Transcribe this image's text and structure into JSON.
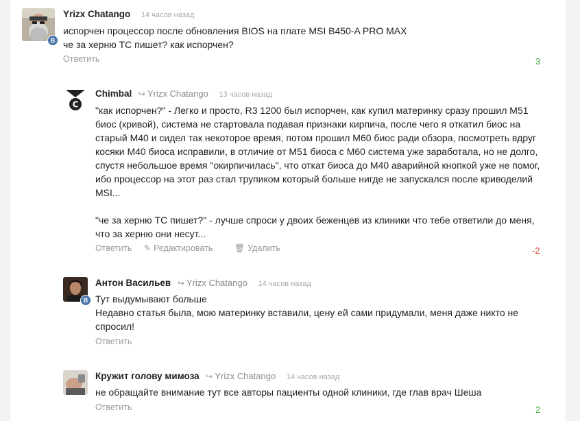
{
  "comments": [
    {
      "author": "Yrizx Chatango",
      "reply_to": "",
      "time": "14 часов назад",
      "lines": [
        "испорчен процессор после обновления BIOS на плате MSI B450-A PRO MAX",
        "че за херню ТС пишет? как испорчен?"
      ],
      "actions": [
        "Ответить"
      ],
      "score": "3",
      "score_color": "#3fa93f",
      "avatar_icon": "bearded-man-avatar",
      "badge": "B"
    },
    {
      "author": "Chimbal",
      "reply_to": "Yrizx Chatango",
      "time": "13 часов назад",
      "lines": [
        "\"как испорчен?\" - Легко и просто, R3 1200 был испорчен, как купил материнку сразу прошил M51",
        "биос (кривой), система не стартовала подавая признаки кирпича, после чего я откатил биос на",
        "старый M40 и сидел так некоторое время, потом прошил M60 биос ради обзора, посмотреть вдруг",
        "косяки M40 биоса исправили, в отличие от M51 биоса с M60 система уже заработала, но не долго,",
        "спустя небольшое время \"окирпичилась\", что откат биоса до M40 аварийной кнопкой уже не помог,",
        "ибо процессор на этот раз стал трупиком который больше нигде не запускался после криводелий",
        "MSI...",
        "",
        "\"че за херню ТС пишет?\" - лучше спроси у двоих беженцев из клиники что тебе ответили до меня,",
        "что за херню они несут..."
      ],
      "actions": [
        "Ответить",
        "Редактировать",
        "Удалить"
      ],
      "score": "-2",
      "score_color": "#d9423a",
      "avatar_icon": "copyright-logo-avatar",
      "badge": ""
    },
    {
      "author": "Антон Васильев",
      "reply_to": "Yrizx Chatango",
      "time": "14 часов назад",
      "lines": [
        "Тут выдумывают больше",
        "Недавно статья была, мою материнку вставили, цену ей сами придумали, меня даже никто не",
        "спросил!"
      ],
      "actions": [
        "Ответить"
      ],
      "score": "",
      "score_color": "",
      "avatar_icon": "man-portrait-avatar",
      "badge": "B"
    },
    {
      "author": "Кружит голову мимоза",
      "reply_to": "Yrizx Chatango",
      "time": "14 часов назад",
      "lines": [
        "не обращайте внимание тут все авторы пациенты  одной клиники, где глав врач Шеша"
      ],
      "actions": [
        "Ответить"
      ],
      "score": "2",
      "score_color": "#3fa93f",
      "avatar_icon": "hand-photo-avatar",
      "badge": ""
    }
  ]
}
